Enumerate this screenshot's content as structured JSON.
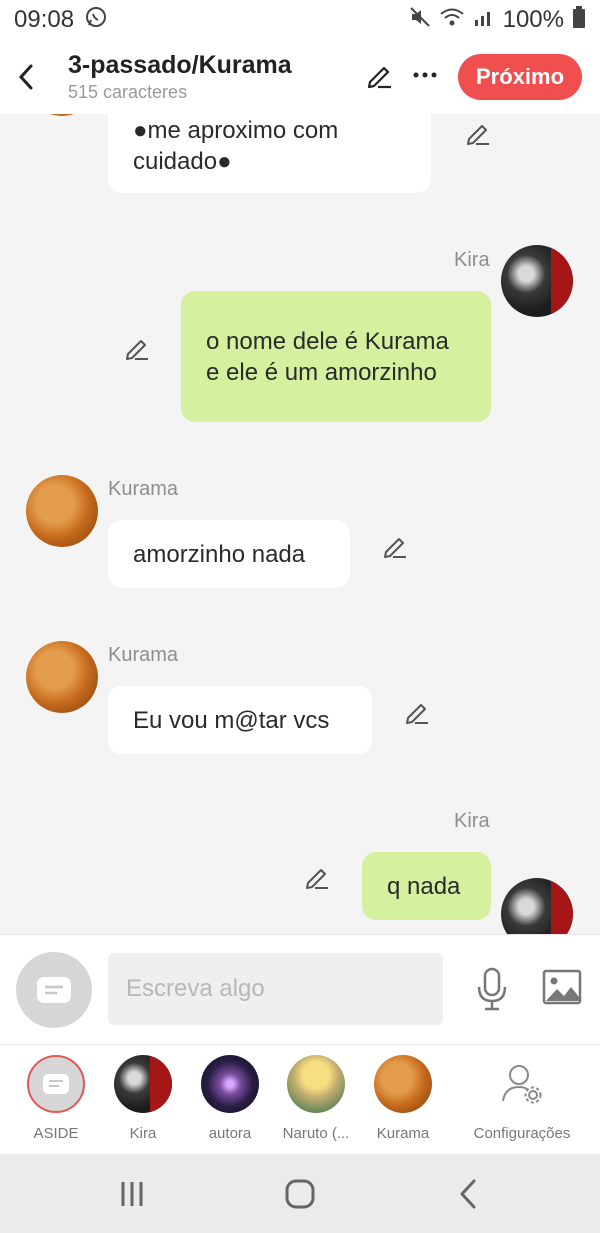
{
  "status": {
    "time": "09:08",
    "battery": "100%"
  },
  "header": {
    "title": "3-passado/Kurama",
    "subtitle": "515 caracteres",
    "next_label": "Próximo"
  },
  "messages": [
    {
      "text": "●me aproximo com cuidado●",
      "sender": ""
    },
    {
      "sender": "Kira",
      "text": "o nome dele é Kurama e ele é um amorzinho"
    },
    {
      "sender": "Kurama",
      "text": "amorzinho nada"
    },
    {
      "sender": "Kurama",
      "text": "Eu vou m@tar vcs"
    },
    {
      "sender": "Kira",
      "text": "q nada"
    }
  ],
  "composer": {
    "placeholder": "Escreva algo"
  },
  "characters": [
    {
      "label": "ASIDE"
    },
    {
      "label": "Kira"
    },
    {
      "label": "autora"
    },
    {
      "label": "Naruto (..."
    },
    {
      "label": "Kurama"
    },
    {
      "label": "Configurações"
    }
  ],
  "colors": {
    "accent": "#ef4f4f",
    "outgoing_bubble": "#d5f1a0",
    "incoming_bubble": "#ffffff"
  }
}
